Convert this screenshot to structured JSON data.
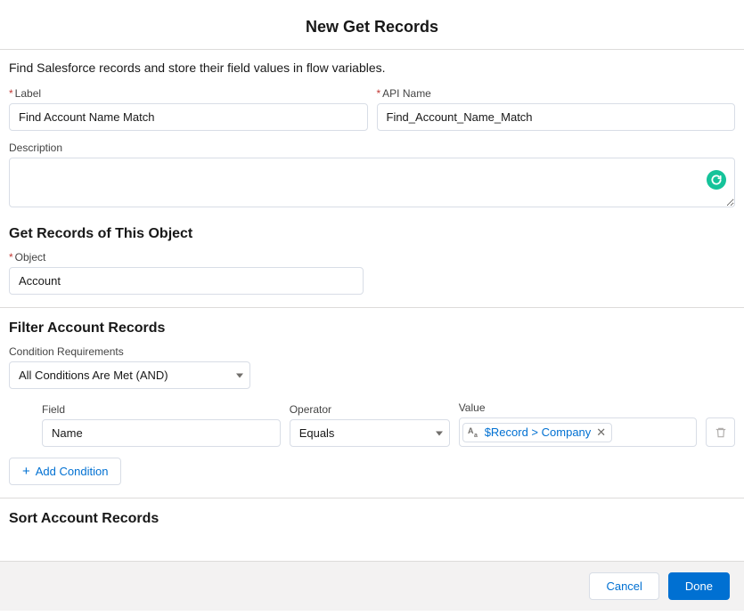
{
  "modal_title": "New Get Records",
  "intro_text": "Find Salesforce records and store their field values in flow variables.",
  "fields": {
    "label_label": "Label",
    "label_value": "Find Account Name Match",
    "api_name_label": "API Name",
    "api_name_value": "Find_Account_Name_Match",
    "description_label": "Description",
    "description_value": ""
  },
  "object_section": {
    "heading": "Get Records of This Object",
    "object_label": "Object",
    "object_value": "Account"
  },
  "filter_section": {
    "heading": "Filter Account Records",
    "condition_req_label": "Condition Requirements",
    "condition_req_value": "All Conditions Are Met (AND)",
    "field_label": "Field",
    "field_value": "Name",
    "operator_label": "Operator",
    "operator_value": "Equals",
    "value_label": "Value",
    "value_pill_text": "$Record > Company",
    "add_condition_label": "Add Condition"
  },
  "sort_section": {
    "heading": "Sort Account Records"
  },
  "footer": {
    "cancel_label": "Cancel",
    "done_label": "Done"
  },
  "icons": {
    "grammarly": "G"
  }
}
